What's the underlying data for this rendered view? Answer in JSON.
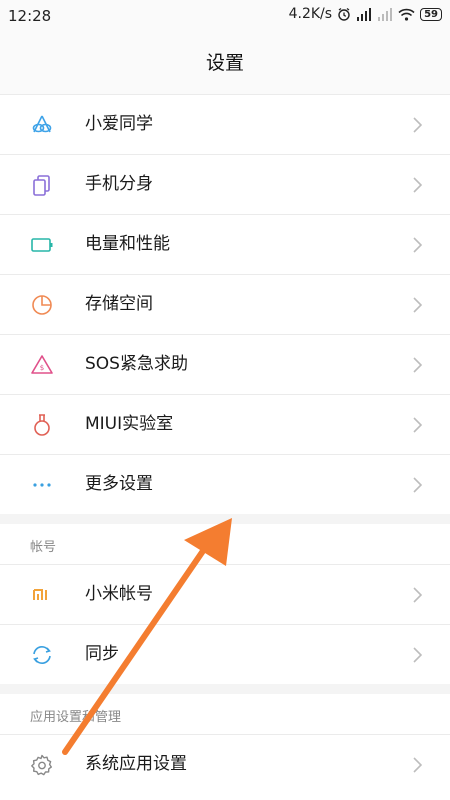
{
  "status_bar": {
    "time": "12:28",
    "speed": "4.2K/s",
    "battery": "59"
  },
  "header": {
    "title": "设置"
  },
  "items": [
    {
      "label": "小爱同学",
      "icon": "xiaoai-icon",
      "color": "#3fa3e8"
    },
    {
      "label": "手机分身",
      "icon": "dual-phone-icon",
      "color": "#8a6fd8"
    },
    {
      "label": "电量和性能",
      "icon": "battery-icon",
      "color": "#27b6a8"
    },
    {
      "label": "存储空间",
      "icon": "storage-pie-icon",
      "color": "#f08a54"
    },
    {
      "label": "SOS紧急求助",
      "icon": "sos-icon",
      "color": "#e0508a"
    },
    {
      "label": "MIUI实验室",
      "icon": "flask-icon",
      "color": "#e06055"
    },
    {
      "label": "更多设置",
      "icon": "more-dots-icon",
      "color": "#3aa0e0"
    }
  ],
  "account_section": {
    "title": "帐号",
    "items": [
      {
        "label": "小米帐号",
        "icon": "mi-logo-icon",
        "color": "#f2a33a"
      },
      {
        "label": "同步",
        "icon": "sync-icon",
        "color": "#3aa0e0"
      }
    ]
  },
  "apps_section": {
    "title": "应用设置和管理",
    "items": [
      {
        "label": "系统应用设置",
        "icon": "gear-icon",
        "color": "#888888"
      }
    ]
  },
  "annotation": {
    "color": "#f47d30"
  }
}
